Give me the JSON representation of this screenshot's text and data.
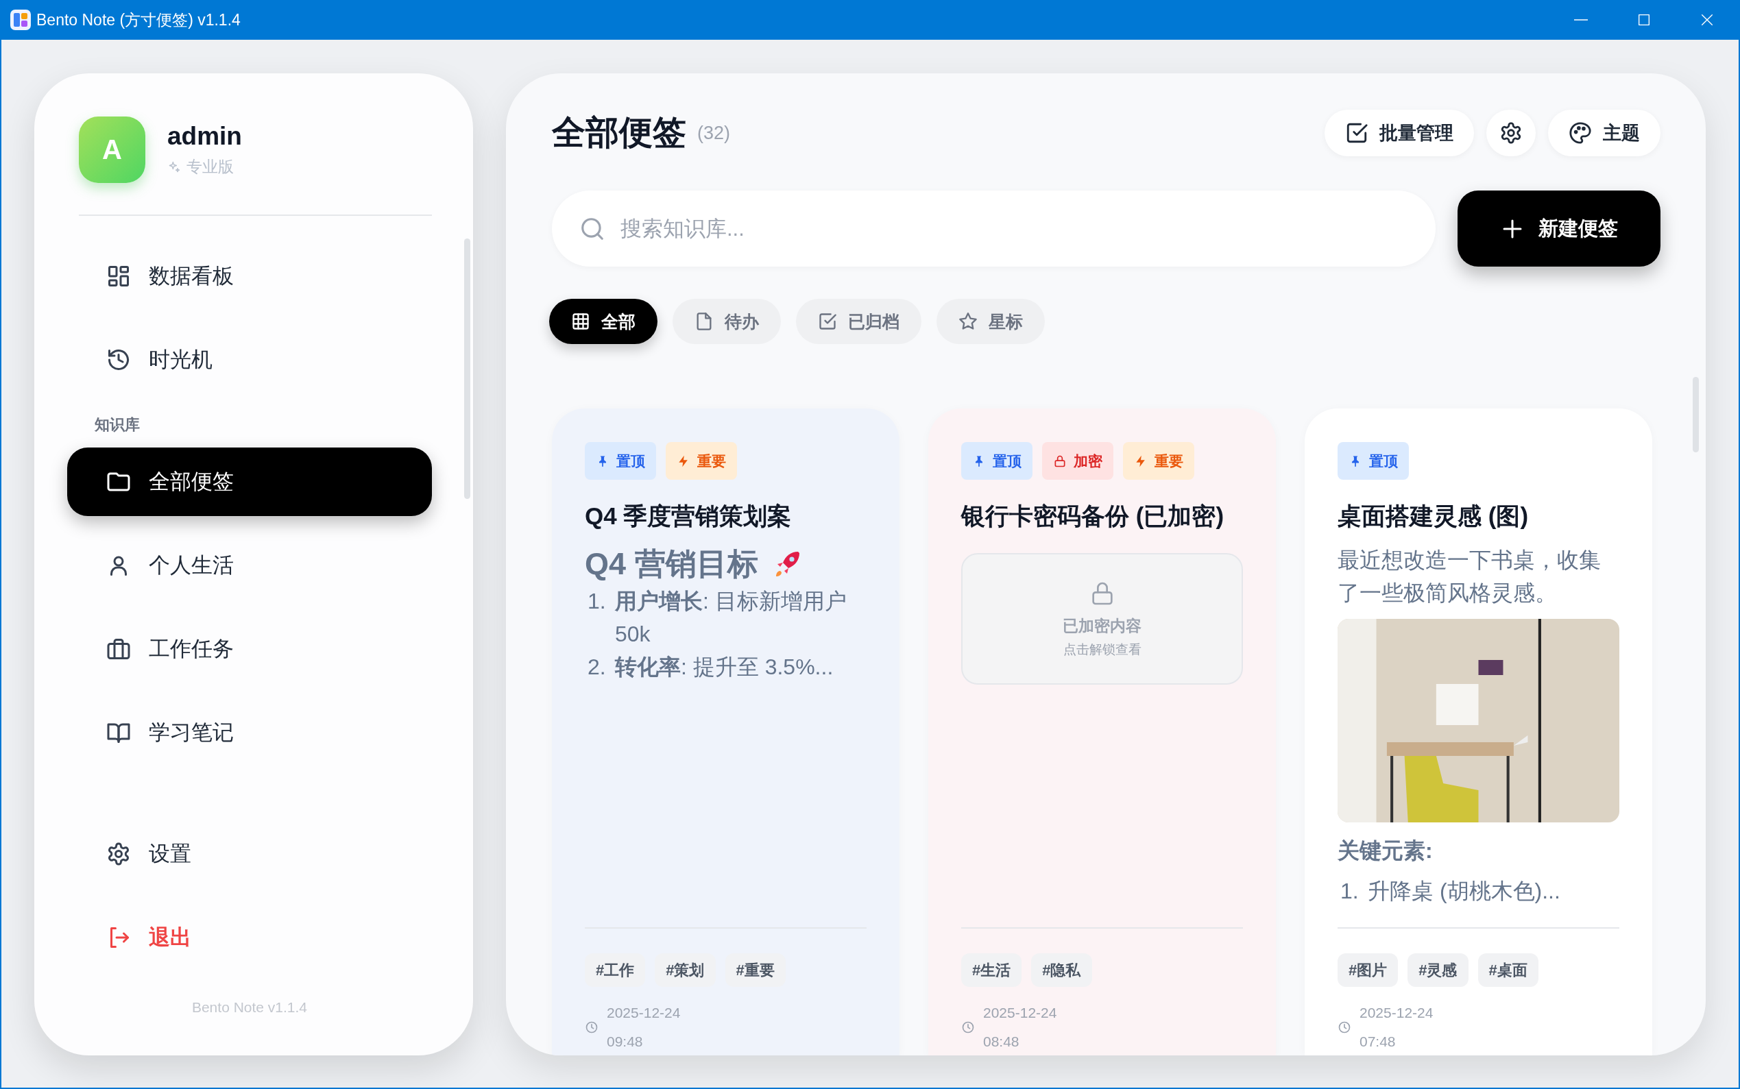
{
  "window": {
    "title": "Bento Note (方寸便签) v1.1.4"
  },
  "sidebar": {
    "user": {
      "avatar": "A",
      "name": "admin",
      "plan": "专业版"
    },
    "nav": [
      {
        "label": "数据看板",
        "selected": false
      },
      {
        "label": "时光机",
        "selected": false
      }
    ],
    "section_label": "知识库",
    "folders": [
      {
        "label": "全部便签",
        "selected": true
      },
      {
        "label": "个人生活",
        "selected": false
      },
      {
        "label": "工作任务",
        "selected": false
      },
      {
        "label": "学习笔记",
        "selected": false
      }
    ],
    "footer": [
      {
        "label": "设置",
        "kind": "normal"
      },
      {
        "label": "退出",
        "kind": "danger"
      }
    ],
    "version": "Bento Note v1.1.4"
  },
  "main": {
    "title": "全部便签",
    "count": "(32)",
    "actions": [
      {
        "kind": "labeled",
        "label": "批量管理"
      },
      {
        "kind": "icon"
      },
      {
        "kind": "labeled",
        "label": "主题"
      }
    ],
    "search": {
      "placeholder": "搜索知识库..."
    },
    "new_button": "新建便签",
    "filters": [
      {
        "label": "全部",
        "selected": true
      },
      {
        "label": "待办",
        "selected": false
      },
      {
        "label": "已归档",
        "selected": false
      },
      {
        "label": "星标",
        "selected": false
      }
    ],
    "cards": [
      {
        "kind": "markdown",
        "color": "#eff3fb",
        "badges": [
          {
            "kind": "pin",
            "label": "置顶"
          },
          {
            "kind": "important",
            "label": "重要"
          }
        ],
        "title": "Q4 季度营销策划案",
        "heading": "Q4 营销目标",
        "list": [
          {
            "number": "1.",
            "text": "**用户增长**: 目标新增用户 50k"
          },
          {
            "number": "2.",
            "text": "**转化率**: 提升至 3.5%..."
          }
        ],
        "tags": [
          "#工作",
          "#策划",
          "#重要"
        ],
        "date": "2025-12-24",
        "time": "09:48"
      },
      {
        "kind": "locked",
        "color": "#fcf3f5",
        "badges": [
          {
            "kind": "pin",
            "label": "置顶"
          },
          {
            "kind": "lock",
            "label": "加密"
          },
          {
            "kind": "important",
            "label": "重要"
          }
        ],
        "title": "银行卡密码备份 (已加密)",
        "locked": {
          "title": "已加密内容",
          "hint": "点击解锁查看"
        },
        "tags": [
          "#生活",
          "#隐私"
        ],
        "date": "2025-12-24",
        "time": "08:48"
      },
      {
        "kind": "image",
        "color": "#ffffff",
        "badges": [
          {
            "kind": "pin",
            "label": "置顶"
          }
        ],
        "title": "桌面搭建灵感 (图)",
        "text": "最近想改造一下书桌，收集了一些极简风格灵感。",
        "subheading": "关键元素:",
        "list": [
          {
            "number": "1.",
            "text": "升降桌 (胡桃木色)..."
          }
        ],
        "tags": [
          "#图片",
          "#灵感",
          "#桌面"
        ],
        "date": "2025-12-24",
        "time": "07:48"
      }
    ]
  }
}
